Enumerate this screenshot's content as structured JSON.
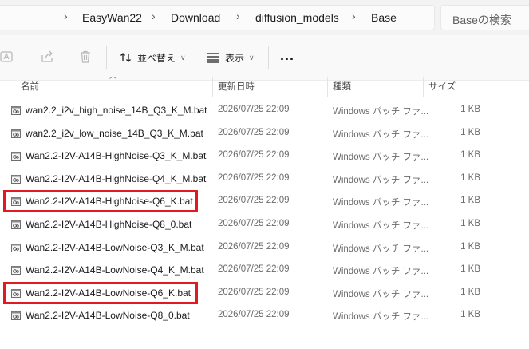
{
  "breadcrumb": [
    "EasyWan22",
    "Download",
    "diffusion_models",
    "Base"
  ],
  "search": {
    "placeholder": "Baseの検索"
  },
  "toolbar": {
    "sort_label": "並べ替え",
    "view_label": "表示",
    "more_label": "..."
  },
  "columns": {
    "name": "名前",
    "date": "更新日時",
    "type": "種類",
    "size": "サイズ"
  },
  "accent_color": "#e11920",
  "files": [
    {
      "name": "wan2.2_i2v_high_noise_14B_Q3_K_M.bat",
      "date": "2026/07/25 22:09",
      "type": "Windows バッチ ファ...",
      "size": "1 KB",
      "highlighted": false
    },
    {
      "name": "wan2.2_i2v_low_noise_14B_Q3_K_M.bat",
      "date": "2026/07/25 22:09",
      "type": "Windows バッチ ファ...",
      "size": "1 KB",
      "highlighted": false
    },
    {
      "name": "Wan2.2-I2V-A14B-HighNoise-Q3_K_M.bat",
      "date": "2026/07/25 22:09",
      "type": "Windows バッチ ファ...",
      "size": "1 KB",
      "highlighted": false
    },
    {
      "name": "Wan2.2-I2V-A14B-HighNoise-Q4_K_M.bat",
      "date": "2026/07/25 22:09",
      "type": "Windows バッチ ファ...",
      "size": "1 KB",
      "highlighted": false
    },
    {
      "name": "Wan2.2-I2V-A14B-HighNoise-Q6_K.bat",
      "date": "2026/07/25 22:09",
      "type": "Windows バッチ ファ...",
      "size": "1 KB",
      "highlighted": true
    },
    {
      "name": "Wan2.2-I2V-A14B-HighNoise-Q8_0.bat",
      "date": "2026/07/25 22:09",
      "type": "Windows バッチ ファ...",
      "size": "1 KB",
      "highlighted": false
    },
    {
      "name": "Wan2.2-I2V-A14B-LowNoise-Q3_K_M.bat",
      "date": "2026/07/25 22:09",
      "type": "Windows バッチ ファ...",
      "size": "1 KB",
      "highlighted": false
    },
    {
      "name": "Wan2.2-I2V-A14B-LowNoise-Q4_K_M.bat",
      "date": "2026/07/25 22:09",
      "type": "Windows バッチ ファ...",
      "size": "1 KB",
      "highlighted": false
    },
    {
      "name": "Wan2.2-I2V-A14B-LowNoise-Q6_K.bat",
      "date": "2026/07/25 22:09",
      "type": "Windows バッチ ファ...",
      "size": "1 KB",
      "highlighted": true
    },
    {
      "name": "Wan2.2-I2V-A14B-LowNoise-Q8_0.bat",
      "date": "2026/07/25 22:09",
      "type": "Windows バッチ ファ...",
      "size": "1 KB",
      "highlighted": false
    }
  ]
}
